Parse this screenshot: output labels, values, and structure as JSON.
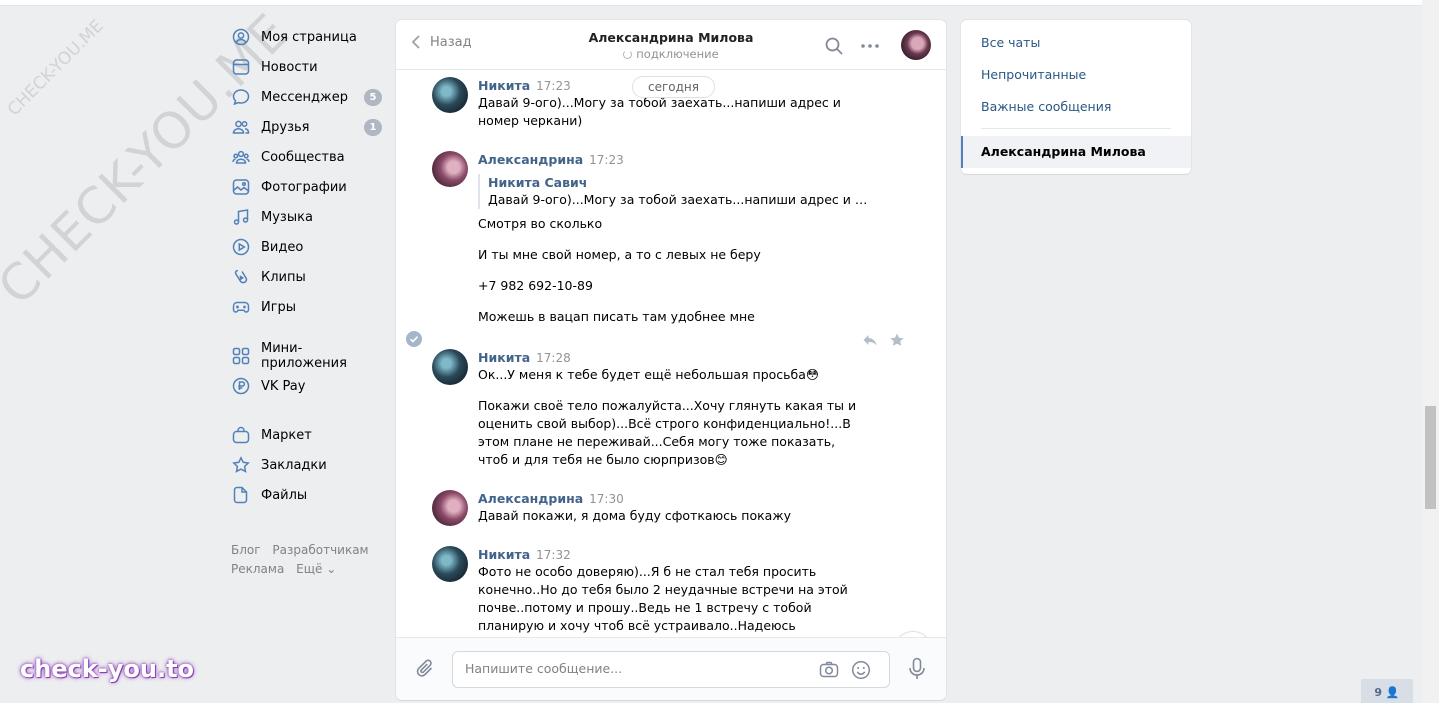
{
  "watermarks": {
    "big": "CHECK-YOU.ME",
    "small": "CHECK-YOU.ME",
    "brand": "check-you.to"
  },
  "nav": {
    "items": [
      {
        "label": "Моя страница",
        "icon": "user-circle-icon"
      },
      {
        "label": "Новости",
        "icon": "news-icon"
      },
      {
        "label": "Мессенджер",
        "icon": "messenger-icon",
        "badge": "5"
      },
      {
        "label": "Друзья",
        "icon": "friends-icon",
        "badge": "1"
      },
      {
        "label": "Сообщества",
        "icon": "communities-icon"
      },
      {
        "label": "Фотографии",
        "icon": "photos-icon"
      },
      {
        "label": "Музыка",
        "icon": "music-icon"
      },
      {
        "label": "Видео",
        "icon": "video-icon"
      },
      {
        "label": "Клипы",
        "icon": "clips-icon"
      },
      {
        "label": "Игры",
        "icon": "games-icon"
      },
      {
        "label": "Мини-приложения",
        "icon": "mini-apps-icon"
      },
      {
        "label": "VK Pay",
        "icon": "vk-pay-icon"
      },
      {
        "label": "Маркет",
        "icon": "market-icon"
      },
      {
        "label": "Закладки",
        "icon": "bookmarks-icon"
      },
      {
        "label": "Файлы",
        "icon": "files-icon"
      }
    ],
    "footer": {
      "blog": "Блог",
      "dev": "Разработчикам",
      "ads": "Реклама",
      "more": "Ещё ⌄"
    }
  },
  "chat": {
    "back_label": "Назад",
    "peer_name": "Александрина Милова",
    "peer_status": "подключение",
    "date_pill": "сегодня",
    "messages": [
      {
        "author": "Никита",
        "time": "17:23",
        "text": "Давай 9-ого)...Могу за тобой заехать...напиши адрес и номер черкани)"
      },
      {
        "author": "Александрина",
        "time": "17:23",
        "forward": {
          "author": "Никита Савич",
          "text": "Давай 9-ого)...Могу за тобой заехать...напиши адрес и номер черкани)"
        },
        "paragraphs": [
          "Смотря во сколько",
          "И ты мне свой номер, а то с левых не беру",
          "+7 982 692-10-89",
          "Можешь в вацап писать там удобнее мне"
        ]
      },
      {
        "author": "Никита",
        "time": "17:28",
        "paragraphs": [
          "Ок...У меня к тебе будет ещё небольшая просьба😳",
          "Покажи своё тело пожалуйста...Хочу глянуть какая ты и оценить свой выбор)...Всё строго конфиденциально!...В этом плане не переживай...Себя могу тоже показать, чтоб и для тебя не было сюрпризов😊"
        ]
      },
      {
        "author": "Александрина",
        "time": "17:30",
        "text": "Давай покажи, я дома буду сфоткаюсь покажу"
      },
      {
        "author": "Никита",
        "time": "17:32",
        "text": "Фото не особо доверяю)...Я б не стал тебя просить конечно..Но до тебя было 2 неудачные встречи на этой почве..потому и прошу..Ведь не 1 встречу с тобой планирую и хочу чтоб всё устраивало..Надеюсь понимаешь меня...Давай"
      }
    ],
    "composer": {
      "placeholder": "Напишите сообщение..."
    }
  },
  "rightpanel": {
    "all_chats": "Все чаты",
    "unread": "Непрочитанные",
    "important": "Важные сообщения",
    "active_chat": "Александрина Милова"
  },
  "corner_badge": "9 👤",
  "colors": {
    "accent": "#2a5885",
    "author": "#42648b",
    "badge": "#aeb7c2",
    "bg": "#edeef0"
  }
}
